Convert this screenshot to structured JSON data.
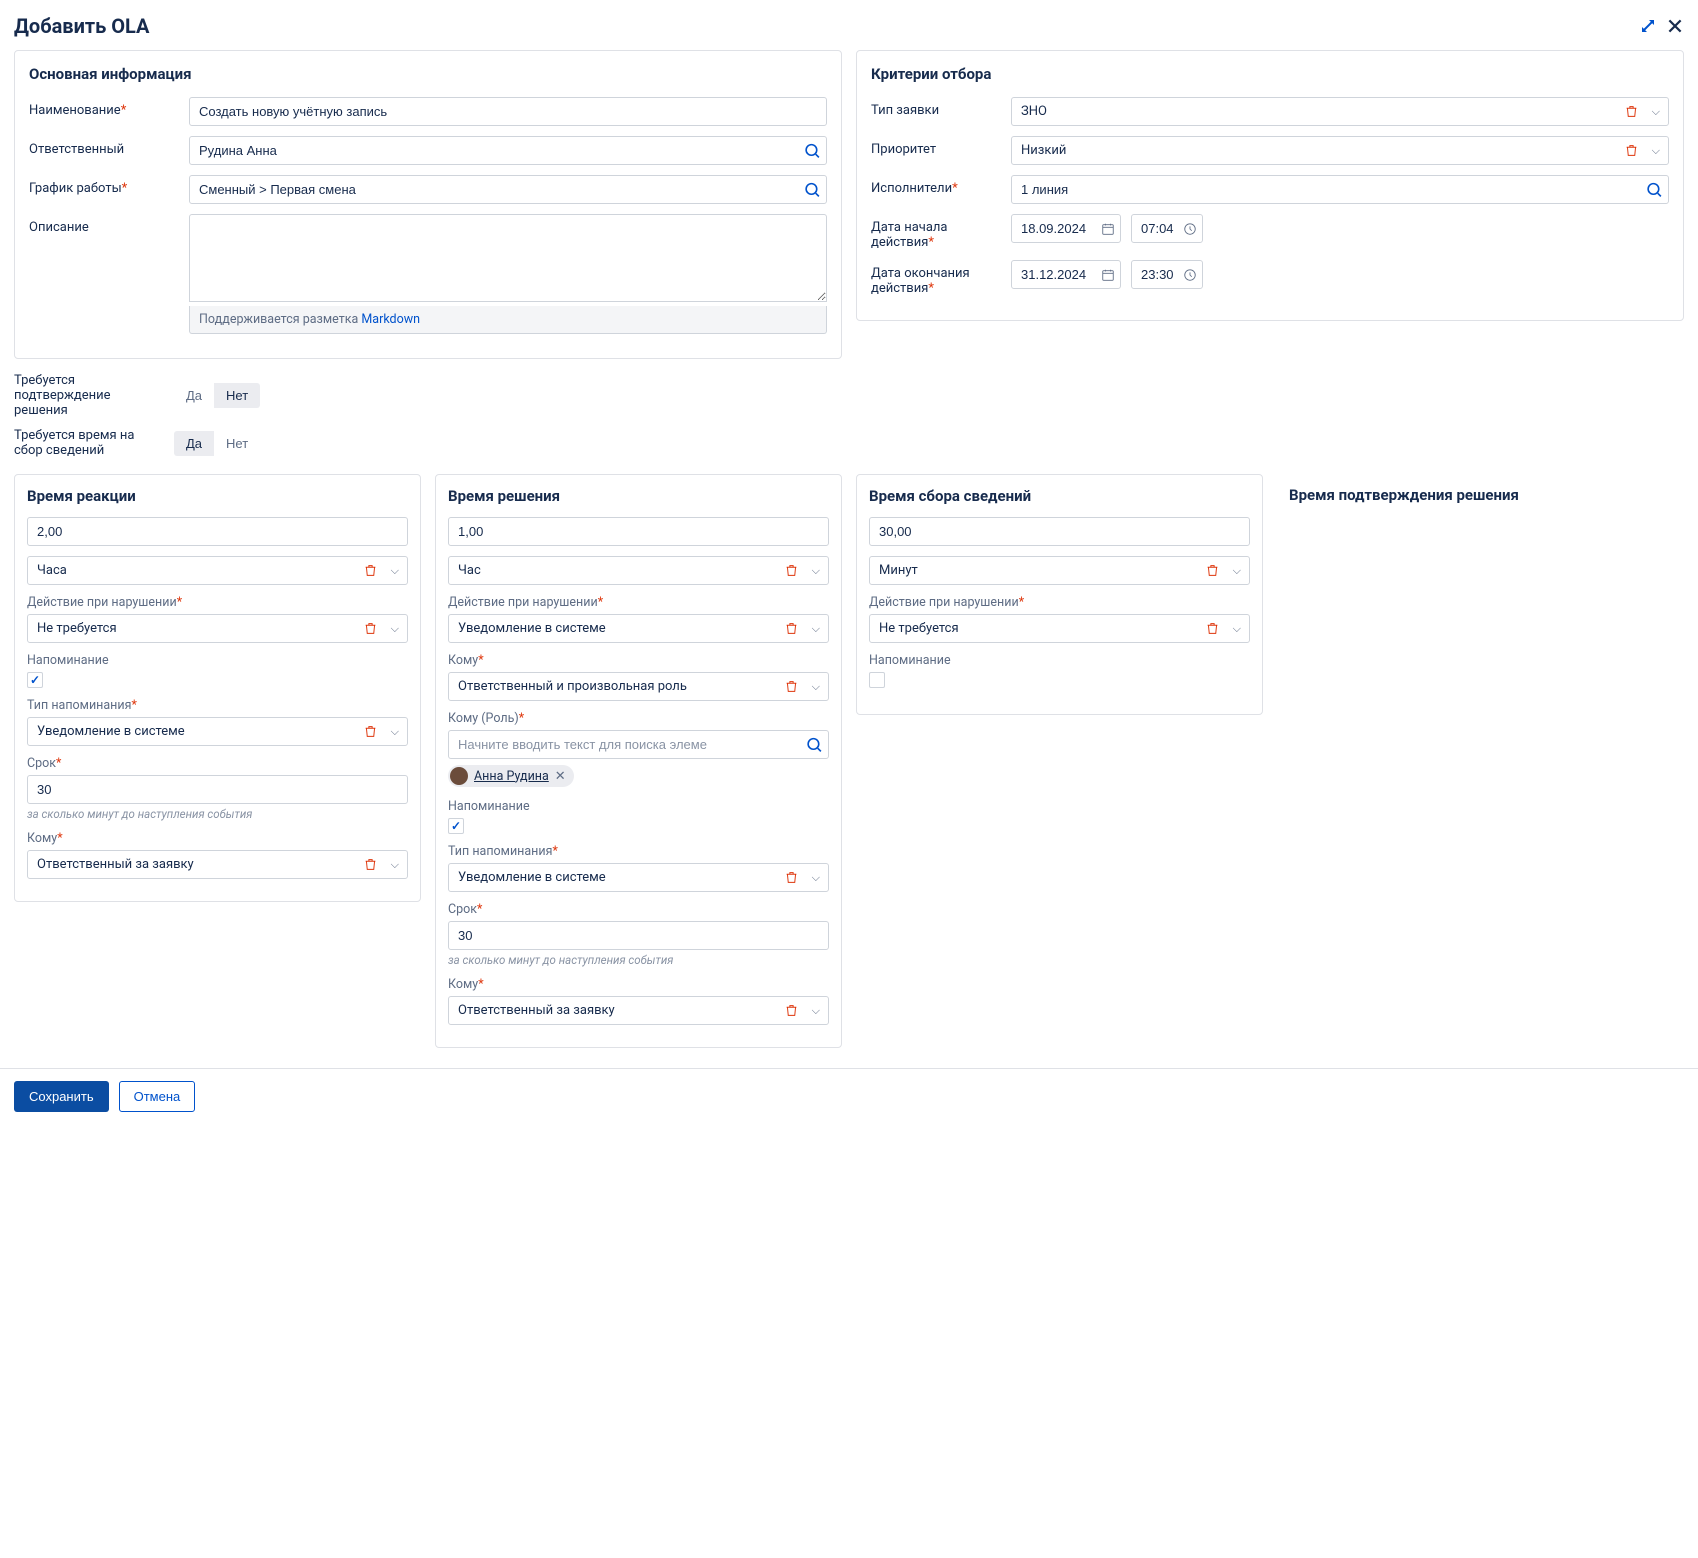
{
  "header": {
    "title": "Добавить OLA"
  },
  "mainInfo": {
    "title": "Основная информация",
    "nameLabel": "Наименование",
    "nameValue": "Создать новую учётную запись",
    "ownerLabel": "Ответственный",
    "ownerValue": "Рудина Анна",
    "scheduleLabel": "График работы",
    "scheduleValue": "Сменный > Первая смена",
    "descLabel": "Описание",
    "markdownPrefix": "Поддерживается разметка ",
    "markdownLink": "Markdown"
  },
  "criteria": {
    "title": "Критерии отбора",
    "typeLabel": "Тип заявки",
    "typeValue": "ЗНО",
    "priorityLabel": "Приоритет",
    "priorityValue": "Низкий",
    "execLabel": "Исполнители",
    "execValue": "1 линия",
    "startLabel": "Дата начала действия",
    "startDate": "18.09.2024",
    "startTime": "07:04",
    "endLabel": "Дата окончания действия",
    "endDate": "31.12.2024",
    "endTime": "23:30"
  },
  "confirm": {
    "label": "Требуется подтверждение решения",
    "yes": "Да",
    "no": "Нет"
  },
  "gather": {
    "label": "Требуется время на сбор сведений",
    "yes": "Да",
    "no": "Нет"
  },
  "common": {
    "violationLabel": "Действие при нарушении",
    "reminderLabel": "Напоминание",
    "reminderTypeLabel": "Тип напоминания",
    "termLabel": "Срок",
    "termHint": "за сколько минут до наступления события",
    "whomLabel": "Кому",
    "whomRoleLabel": "Кому (Роль)",
    "rolePlaceholder": "Начните вводить текст для поиска элеме"
  },
  "reaction": {
    "title": "Время реакции",
    "value": "2,00",
    "unit": "Часа",
    "violation": "Не требуется",
    "reminderType": "Уведомление в системе",
    "term": "30",
    "whom": "Ответственный за заявку"
  },
  "resolution": {
    "title": "Время решения",
    "value": "1,00",
    "unit": "Час",
    "violation": "Уведомление в системе",
    "whom1": "Ответственный и произвольная роль",
    "chipName": "Анна Рудина",
    "reminderType": "Уведомление в системе",
    "term": "30",
    "whom2": "Ответственный за заявку"
  },
  "gatherTime": {
    "title": "Время сбора сведений",
    "value": "30,00",
    "unit": "Минут",
    "violation": "Не требуется"
  },
  "confirmTime": {
    "title": "Время подтверждения решения"
  },
  "footer": {
    "save": "Сохранить",
    "cancel": "Отмена"
  }
}
